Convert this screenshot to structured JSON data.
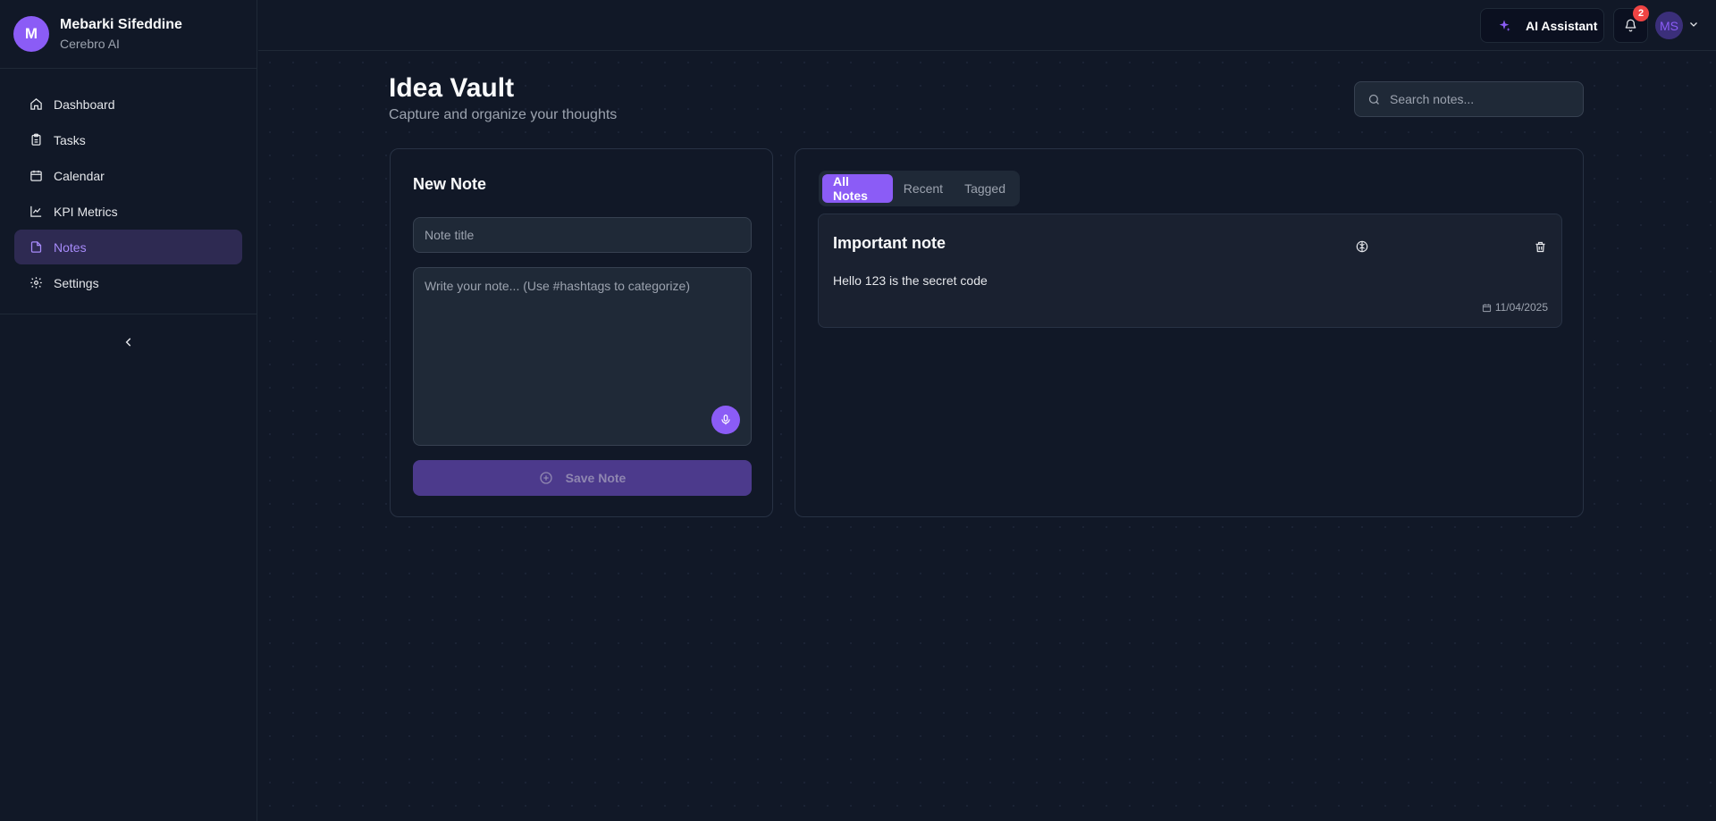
{
  "user": {
    "initial": "M",
    "name": "Mebarki Sifeddine",
    "org": "Cerebro AI",
    "avatar_initials": "MS"
  },
  "sidebar": {
    "items": [
      {
        "label": "Dashboard",
        "icon": "home-icon"
      },
      {
        "label": "Tasks",
        "icon": "clipboard-icon"
      },
      {
        "label": "Calendar",
        "icon": "calendar-icon"
      },
      {
        "label": "KPI Metrics",
        "icon": "chart-line-icon"
      },
      {
        "label": "Notes",
        "icon": "file-icon",
        "active": true
      },
      {
        "label": "Settings",
        "icon": "gear-icon"
      }
    ]
  },
  "topbar": {
    "ai_label": "AI Assistant",
    "notification_count": "2"
  },
  "page": {
    "title": "Idea Vault",
    "subtitle": "Capture and organize your thoughts"
  },
  "search": {
    "placeholder": "Search notes..."
  },
  "new_note": {
    "heading": "New Note",
    "title_placeholder": "Note title",
    "body_placeholder": "Write your note... (Use #hashtags to categorize)",
    "save_label": "Save Note"
  },
  "notes_panel": {
    "tabs": [
      {
        "label": "All Notes",
        "active": true
      },
      {
        "label": "Recent"
      },
      {
        "label": "Tagged"
      }
    ],
    "notes": [
      {
        "title": "Important note",
        "body": "Hello 123 is the secret code",
        "date": "11/04/2025"
      }
    ]
  },
  "colors": {
    "accent": "#8b5cf6",
    "background": "#111827",
    "badge": "#ef4444"
  }
}
